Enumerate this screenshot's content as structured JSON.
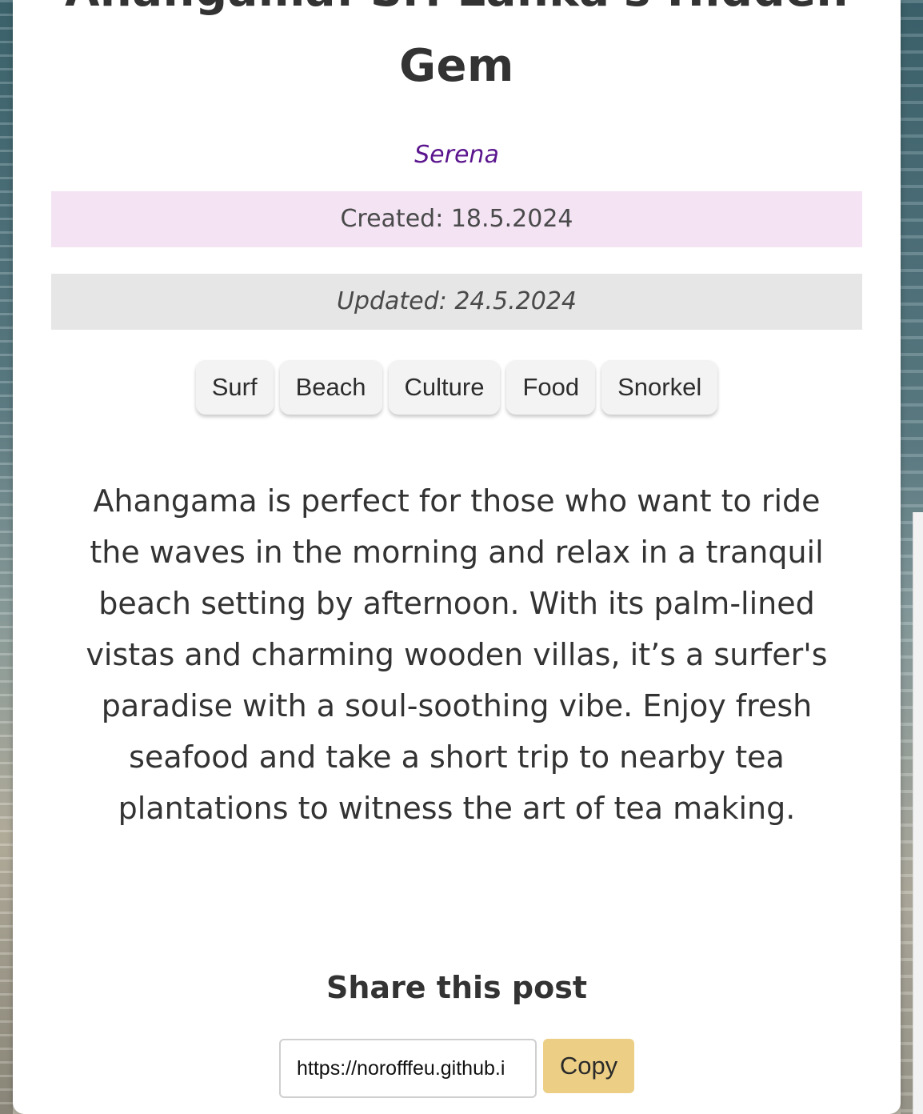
{
  "post": {
    "title": "Ahangama: Sri Lanka's Hidden Gem",
    "author": "Serena",
    "created": "Created: 18.5.2024",
    "updated": "Updated: 24.5.2024",
    "tags": [
      "Surf",
      "Beach",
      "Culture",
      "Food",
      "Snorkel"
    ],
    "body": "Ahangama is perfect for those who want to ride the waves in the morning and relax in a tranquil beach setting by afternoon. With its palm-lined vistas and charming wooden villas, it’s a surfer's paradise with a soul-soothing vibe. Enjoy fresh seafood and take a short trip to nearby tea plantations to witness the art of tea making."
  },
  "share": {
    "heading": "Share this post",
    "url_value": "https://norofffeu.github.i",
    "copy_label": "Copy"
  },
  "colors": {
    "author": "#5b168e",
    "created_bg": "#f3e3f3",
    "updated_bg": "#e6e6e6",
    "copy_button": "#eccf85"
  }
}
